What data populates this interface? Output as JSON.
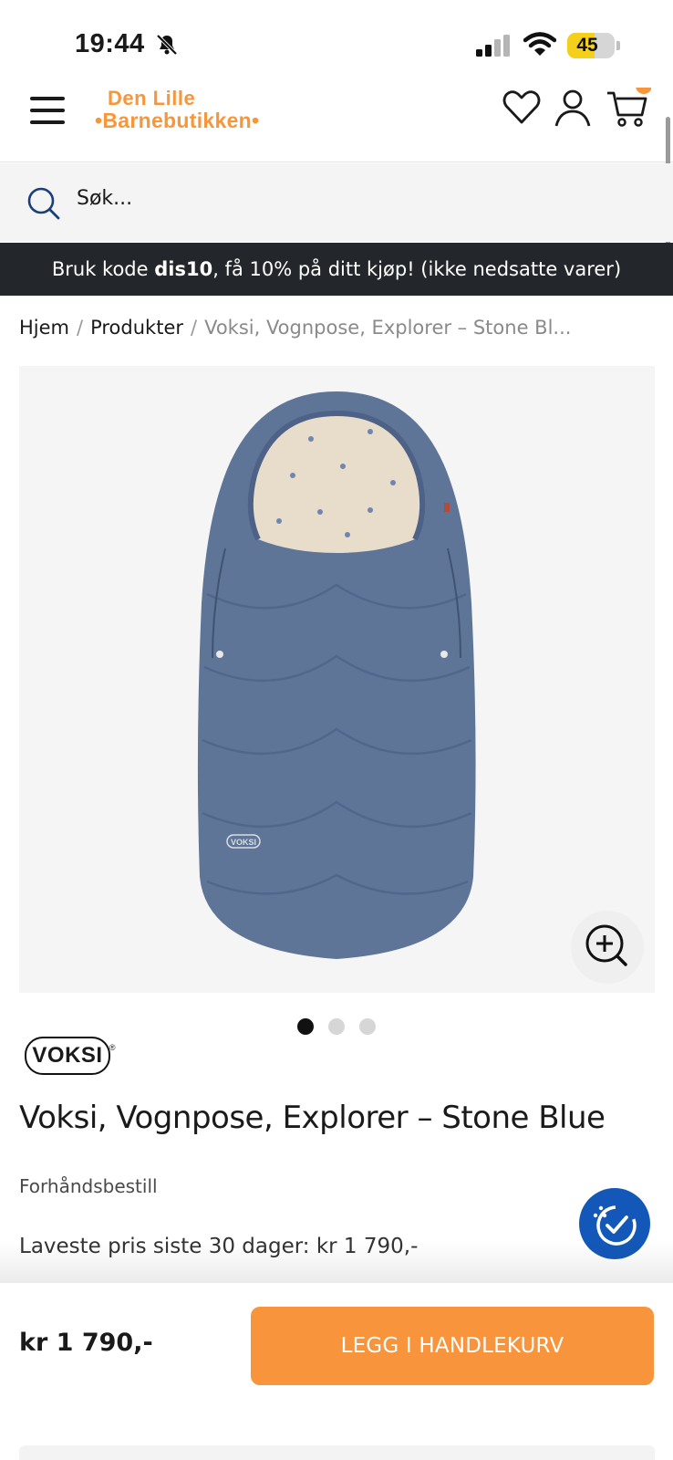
{
  "status_bar": {
    "time": "19:44",
    "battery": "45",
    "battery_level": 0.45
  },
  "header": {
    "logo_line1": "Den Lille",
    "logo_line2": "•Barnebutikken•",
    "cart_count": ""
  },
  "search": {
    "placeholder": "Søk..."
  },
  "promo": {
    "prefix": "Bruk kode ",
    "code": "dis10",
    "suffix": ", få 10% på ditt kjøp! (ikke nedsatte varer)"
  },
  "breadcrumb": {
    "items": [
      "Hjem",
      "Produkter",
      "Voksi, Vognpose, Explorer – Stone Bl..."
    ],
    "separator": "/"
  },
  "gallery": {
    "slide_count": 3,
    "active_slide": 1
  },
  "product": {
    "brand": "VOKSI",
    "brand_reg": "®",
    "brand_logo_text": "VOKSI",
    "title": "Voksi, Vognpose, Explorer – Stone Blue",
    "availability": "Forhåndsbestill",
    "lowest_price": "Laveste pris siste 30 dager: kr 1 790,-",
    "price": "kr 1 790,-",
    "color": "#5f7598"
  },
  "cta": {
    "label": "LEGG I HANDLEKURV"
  },
  "colors": {
    "accent": "#f7963a",
    "promo_bg": "#23272b",
    "a11y_blue": "#1358b8"
  }
}
